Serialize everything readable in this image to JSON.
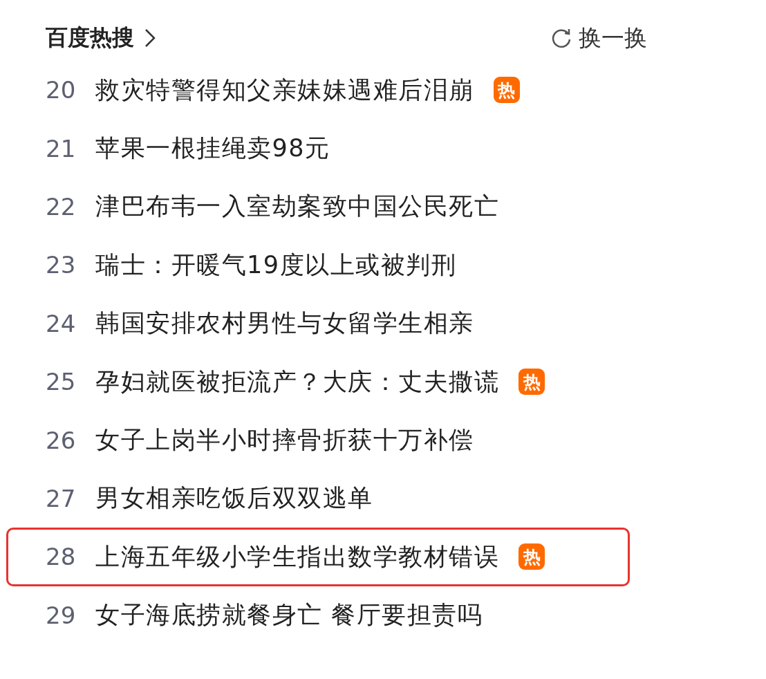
{
  "header": {
    "title": "百度热搜",
    "refresh_label": "换一换"
  },
  "items": [
    {
      "rank": "20",
      "title": "救灾特警得知父亲妹妹遇难后泪崩",
      "badge": "热",
      "highlighted": false
    },
    {
      "rank": "21",
      "title": "苹果一根挂绳卖98元",
      "highlighted": false
    },
    {
      "rank": "22",
      "title": "津巴布韦一入室劫案致中国公民死亡",
      "highlighted": false
    },
    {
      "rank": "23",
      "title": "瑞士：开暖气19度以上或被判刑",
      "highlighted": false
    },
    {
      "rank": "24",
      "title": "韩国安排农村男性与女留学生相亲",
      "highlighted": false
    },
    {
      "rank": "25",
      "title": "孕妇就医被拒流产？大庆：丈夫撒谎",
      "badge": "热",
      "highlighted": false
    },
    {
      "rank": "26",
      "title": "女子上岗半小时摔骨折获十万补偿",
      "highlighted": false
    },
    {
      "rank": "27",
      "title": "男女相亲吃饭后双双逃单",
      "highlighted": false
    },
    {
      "rank": "28",
      "title": "上海五年级小学生指出数学教材错误",
      "badge": "热",
      "highlighted": true
    },
    {
      "rank": "29",
      "title": "女子海底捞就餐身亡 餐厅要担责吗",
      "highlighted": false
    }
  ]
}
